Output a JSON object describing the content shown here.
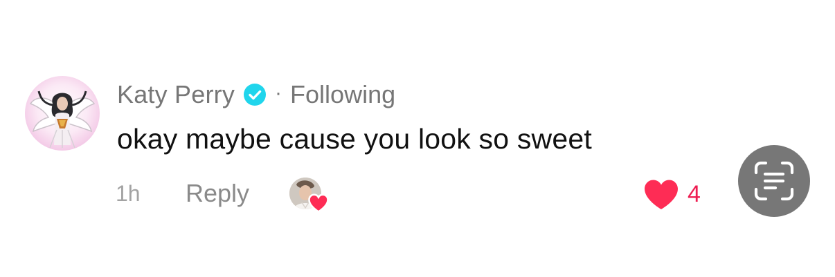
{
  "comment": {
    "author": "Katy Perry",
    "separator": "·",
    "follow_status": "Following",
    "text": "okay maybe cause you look so sweet",
    "time_ago": "1h",
    "reply_label": "Reply",
    "like_count": "4"
  },
  "icons": {
    "verified": "verified-badge-icon",
    "like": "heart-icon",
    "creator_like": "creator-heart-icon",
    "scan": "text-scan-icon"
  },
  "colors": {
    "verified": "#20d5ec",
    "like": "#fe2c55",
    "like_count": "#ee1d52",
    "muted_text": "#767676",
    "scan_button_bg": "#777777"
  }
}
